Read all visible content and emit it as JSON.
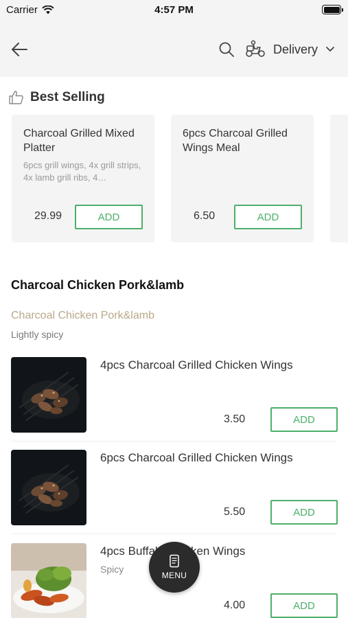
{
  "status_bar": {
    "carrier": "Carrier",
    "time": "4:57 PM"
  },
  "header": {
    "delivery_label": "Delivery"
  },
  "best_selling": {
    "title": "Best Selling",
    "cards": [
      {
        "name": "Charcoal Grilled Mixed Platter",
        "description": "6pcs grill wings, 4x grill strips, 4x lamb grill ribs, 4…",
        "price": "29.99",
        "add_label": "ADD"
      },
      {
        "name": "6pcs Charcoal Grilled Wings Meal",
        "description": "",
        "price": "6.50",
        "add_label": "ADD"
      }
    ]
  },
  "category": {
    "title": "Charcoal Chicken Pork&lamb",
    "subtitle": "Charcoal Chicken Pork&lamb",
    "note": "Lightly spicy"
  },
  "items": [
    {
      "name": "4pcs Charcoal Grilled Chicken Wings",
      "note": "",
      "price": "3.50",
      "add_label": "ADD"
    },
    {
      "name": "6pcs Charcoal Grilled Chicken Wings",
      "note": "",
      "price": "5.50",
      "add_label": "ADD"
    },
    {
      "name": "4pcs Buffalo Chicken Wings",
      "note": "Spicy",
      "price": "4.00",
      "add_label": "ADD"
    }
  ],
  "menu_button": {
    "label": "MENU"
  },
  "colors": {
    "accent": "#4caf6a",
    "subtitle": "#b8a888",
    "header_bg": "#f4f4f4"
  }
}
